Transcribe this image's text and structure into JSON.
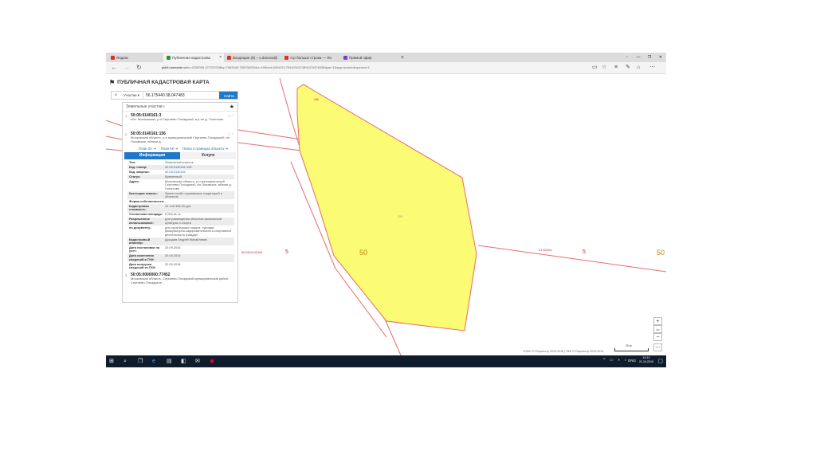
{
  "browser": {
    "tabs": [
      {
        "label": "Яндекс",
        "fav": "#e42d25"
      },
      {
        "label": "Публичная кадастрова",
        "fav": "#2a8f3f",
        "active": true
      },
      {
        "label": "Входящие (9) – o.donova@",
        "fav": "#d93025"
      },
      {
        "label": "стр больше строка — Ян",
        "fav": "#e42d25"
      },
      {
        "label": "Прямой эфир",
        "fav": "#7a40c8"
      }
    ],
    "new_tab": "+",
    "url_host": "pkk5.rosreestr.ru",
    "url_rest": "/#x=4235396.1272370286y=7583445.789236039&z=19&text=56%2C175440%2C38%2C047483&type=1&app=search&opened=1",
    "window_controls": [
      "▫",
      "—",
      "❐",
      "✕"
    ]
  },
  "app": {
    "title": "ПУБЛИЧНАЯ КАДАСТРОВАЯ КАРТА"
  },
  "search": {
    "type": "Участки ▾",
    "value": "56.175440 38.047483",
    "button": "Найти"
  },
  "panel": {
    "header": "Земельные участки",
    "header_sup": "5",
    "results": [
      {
        "num": "1.",
        "cad": "50:05:0140161:3",
        "addr": "обл. Московская, р-н Сергиево-Посадский, в р-не д. Гольтсово"
      },
      {
        "num": "2.",
        "cad": "50:05:0140161:156",
        "addr": "Московская область, р-н муниципальный Сергиево-Посадский, с/п Лозовское, вблизи д..."
      },
      {
        "num": "3.",
        "cad": "50:05:0000000:77452",
        "addr": "Московская область, Сергиево-Посадский муниципальный район, Сергиево-Посадское..."
      }
    ],
    "links": [
      "План ЗУ ⇥",
      "План КК ⇥",
      "Поиск в границах объекта ⇥"
    ],
    "tabs": [
      "Информация",
      "Услуги"
    ],
    "info": [
      {
        "k": "Тип:",
        "v": "Земельный участок"
      },
      {
        "k": "Кад. номер:",
        "v": "50:05:0140161:156",
        "link": true
      },
      {
        "k": "Кад. квартал:",
        "v": "50:05:0140161",
        "link": true
      },
      {
        "k": "Статус:",
        "v": "Временный"
      },
      {
        "k": "Адрес:",
        "v": "Московская область, р-н муниципальный Сергиево-Посадский, с/п Лозовское, вблизи д. Гольтсово"
      },
      {
        "k": "Категория земель:",
        "v": "Земли особо охраняемых территорий и объектов"
      },
      {
        "k": "Форма собственности:",
        "v": "-"
      },
      {
        "k": "Кадастровая стоимость:",
        "v": "10 145 328,00 руб."
      },
      {
        "k": "Уточненная площадь:",
        "v": "8 000 кв. м"
      },
      {
        "k": "Разрешенное использование:",
        "v": "Для размещения объектов физической культуры и спорта"
      },
      {
        "k": "по документу:",
        "v": "для организации отдыха, туризма, физкультурно-оздоровительной и спортивной деятельности граждан"
      },
      {
        "k": "Кадастровый инженер:",
        "v": "Дроздов Андрей Михайлович"
      },
      {
        "k": "Дата постановки на учет:",
        "v": "20.09.2016"
      },
      {
        "k": "Дата изменения сведений в ГКН:",
        "v": "20.09.2016"
      },
      {
        "k": "Дата выгрузки сведений из ГКН:",
        "v": "20.09.2016"
      }
    ]
  },
  "map": {
    "parcel_color": "#fbfb74",
    "boundary_color": "#e86b6b",
    "labels": [
      {
        "t": "50",
        "c": "#b8860b"
      },
      {
        "t": "5",
        "c": "#c62828"
      },
      {
        "t": "50:05:0140161",
        "c": "#c62828"
      },
      {
        "t": "50",
        "c": "#b8860b"
      },
      {
        "t": "5",
        "c": "#c62828"
      },
      {
        "t": "01:40161",
        "c": "#c62828"
      }
    ],
    "attribution": "ЕЭКО © Росреестр 2010-2016 | ПКК © Росреестр 2010-2013",
    "scale": "20 м",
    "controls": [
      "+",
      "−",
      "⋯"
    ]
  },
  "taskbar": {
    "lang": "ENG",
    "time": "13:13",
    "date": "21.10.2016"
  }
}
